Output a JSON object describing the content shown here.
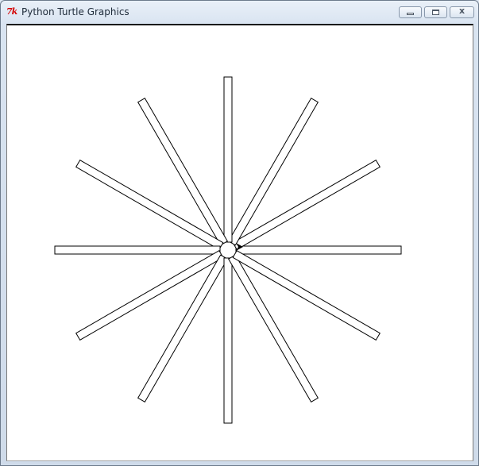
{
  "window": {
    "title": "Python Turtle Graphics",
    "app_icon_text": "7k",
    "close_glyph": "x"
  },
  "drawing": {
    "shape": "star-of-rectangles",
    "spoke_count": 12,
    "angle_step_degrees": 30,
    "stroke_color": "#000000",
    "fill_color": "#ffffff",
    "background_color": "#ffffff",
    "turtle_heading_degrees": 0,
    "turtle_color": "#000000"
  }
}
